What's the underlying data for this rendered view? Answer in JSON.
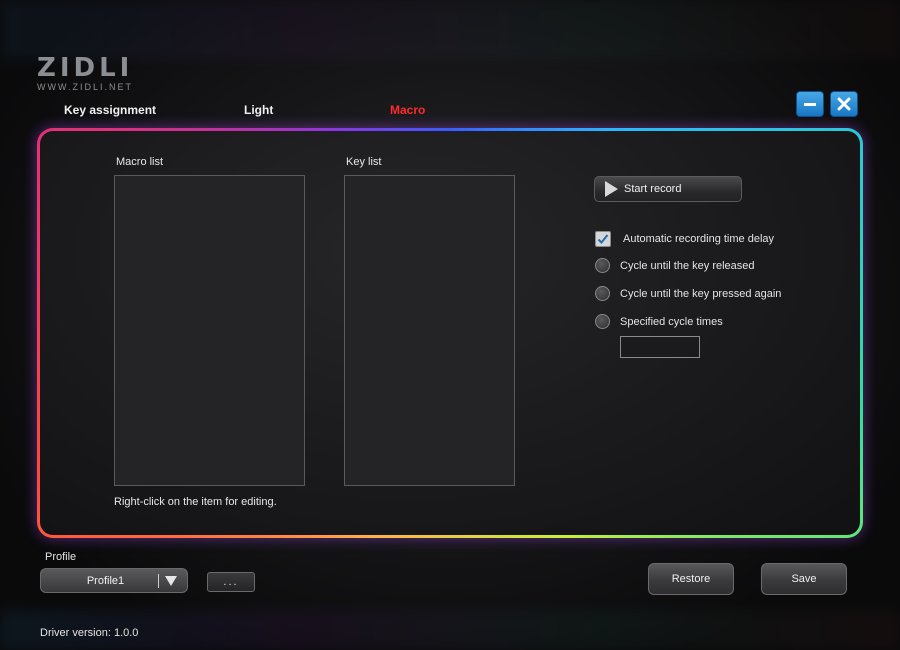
{
  "brand": {
    "name": "ZIDLI",
    "url": "WWW.ZIDLI.NET"
  },
  "tabs": [
    {
      "label": "Key assignment",
      "active": false
    },
    {
      "label": "Light",
      "active": false
    },
    {
      "label": "Macro",
      "active": true
    }
  ],
  "window_controls": {
    "minimize_icon": "minimize-icon",
    "close_icon": "close-icon"
  },
  "macro": {
    "macro_list_label": "Macro list",
    "key_list_label": "Key list",
    "hint": "Right-click on the item for editing.",
    "start_record_label": "Start record",
    "options": [
      {
        "label": "Automatic recording time delay",
        "type": "checkbox",
        "checked": true
      },
      {
        "label": "Cycle until the key released",
        "type": "radio",
        "checked": false
      },
      {
        "label": "Cycle until the key pressed again",
        "type": "radio",
        "checked": false
      },
      {
        "label": "Specified cycle times",
        "type": "radio",
        "checked": false
      }
    ],
    "cycle_times_value": ""
  },
  "footer": {
    "profile_label": "Profile",
    "profile_value": "Profile1",
    "more_label": "...",
    "restore_label": "Restore",
    "save_label": "Save",
    "driver_version": "Driver version:  1.0.0"
  },
  "colors": {
    "active_tab": "#ff2a2a",
    "window_button": "#2a8fd8",
    "checkmark": "#1d6fb8"
  }
}
